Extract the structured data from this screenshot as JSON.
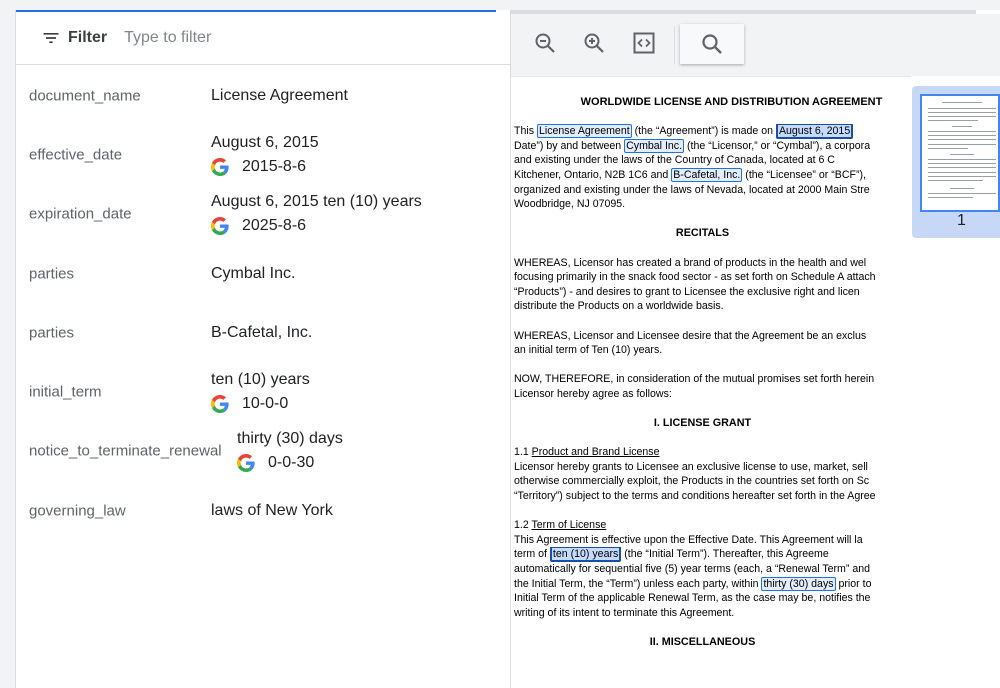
{
  "filter": {
    "label": "Filter",
    "placeholder": "Type to filter"
  },
  "fields": [
    {
      "key": "document_name",
      "value": "License Agreement"
    },
    {
      "key": "effective_date",
      "value": "August 6, 2015",
      "normalized": "2015-8-6"
    },
    {
      "key": "expiration_date",
      "value": "August 6, 2015 ten (10) years",
      "normalized": "2025-8-6"
    },
    {
      "key": "parties",
      "value": "Cymbal Inc."
    },
    {
      "key": "parties",
      "value": "B-Cafetal, Inc."
    },
    {
      "key": "initial_term",
      "value": "ten (10) years",
      "normalized": "10-0-0"
    },
    {
      "key": "notice_to_terminate_renewal",
      "value": "thirty (30) days",
      "normalized": "0-0-30"
    },
    {
      "key": "governing_law",
      "value": "laws of New York"
    }
  ],
  "toolbar": {
    "icons": [
      "zoom-out-icon",
      "zoom-in-icon",
      "code-icon",
      "search-icon"
    ]
  },
  "document": {
    "title": "WORLDWIDE LICENSE AND DISTRIBUTION AGREEMENT",
    "p1": [
      [
        "This ",
        "License Agreement",
        " (the “Agreement”) is made on ",
        "August 6, 2015"
      ],
      [
        "Date”) by and between ",
        "Cymbal Inc.",
        " (the “Licensor,” or “Cymbal”), a corpora"
      ],
      [
        "and existing under the laws of the Country of Canada, located at 6 C"
      ],
      [
        "Kitchener, Ontario, N2B 1C6 and ",
        "B-Cafetal, Inc.",
        " (the “Licensee” or “BCF”),"
      ],
      [
        "organized and existing under the laws of Nevada, located at 2000 Main Stre"
      ],
      [
        "Woodbridge, NJ 07095."
      ]
    ],
    "recitals": "RECITALS",
    "p2": [
      "WHEREAS, Licensor has created a brand of products in the health and wel",
      "focusing primarily in the snack food sector - as set forth on Schedule A attach",
      "“Products”) - and desires to grant to Licensee the exclusive right and licen",
      "distribute the Products on a worldwide basis."
    ],
    "p3": [
      "WHEREAS, Licensor and Licensee desire that the Agreement be an exclus",
      "an initial term of Ten (10) years."
    ],
    "p4": [
      "NOW, THEREFORE, in consideration of the mutual promises set forth herein",
      "Licensor hereby agree as follows:"
    ],
    "sec1": "I.  LICENSE GRANT",
    "s11_num": "1.1  ",
    "s11_title": "Product and Brand License",
    "p5": [
      "Licensor hereby grants to Licensee an exclusive license to use, market, sell",
      "otherwise commercially exploit, the Products in the countries set forth on Sc",
      "“Territory”) subject to the terms and conditions hereafter set forth in the Agree"
    ],
    "s12_num": "1.2  ",
    "s12_title": "Term of License",
    "p6_1": "This Agreement is effective upon the Effective Date. This Agreement will la",
    "p6_2a": "term of ",
    "p6_2h": "ten (10) years",
    "p6_2b": " (the “Initial Term”). Thereafter, this Agreeme",
    "p6_3": "automatically for sequential five (5) year terms (each, a “Renewal Term” and",
    "p6_4a": "the Initial Term, the “Term”) unless each party, within ",
    "p6_4h": "thirty (30) days",
    "p6_4b": " prior to",
    "p6_5": "Initial Term of the applicable Renewal Term, as the case may be, notifies the",
    "p6_6": "writing of its intent to terminate this Agreement.",
    "sec2": "II. MISCELLANEOUS"
  },
  "thumbnail": {
    "page_number": "1"
  }
}
